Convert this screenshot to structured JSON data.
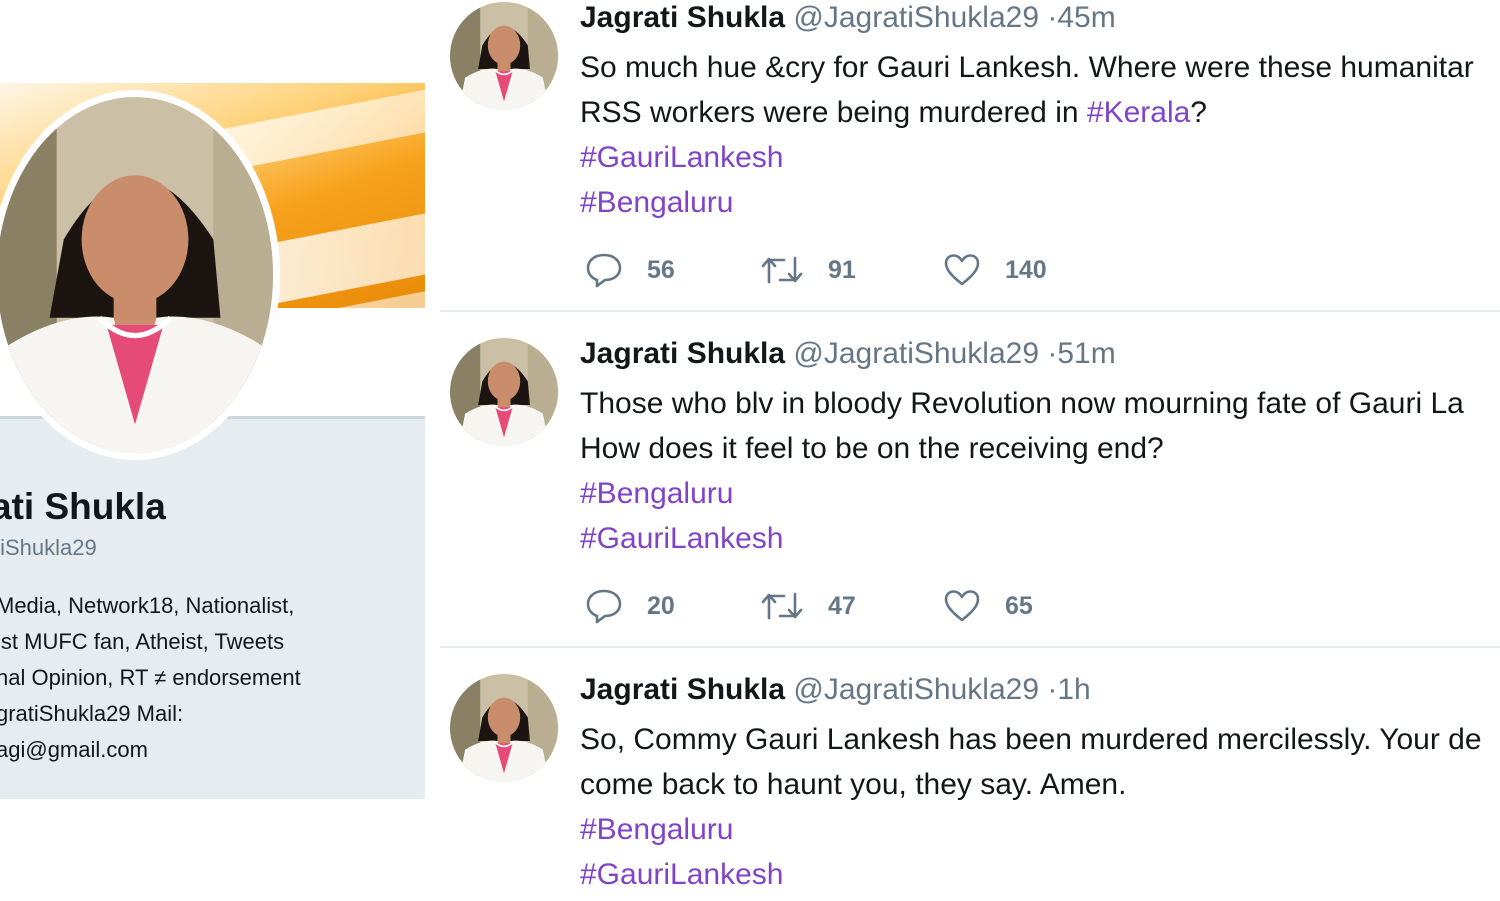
{
  "profile": {
    "name": "ati Shukla",
    "handle": "tiShukla29",
    "bio_lines": [
      "Media, Network18, Nationalist,",
      "ist MUFC fan, Atheist, Tweets",
      "nal Opinion, RT ≠ endorsement",
      "gratiShukla29 Mail:",
      "agi@gmail.com"
    ]
  },
  "tweets": [
    {
      "name": "Jagrati Shukla",
      "handle": "@JagratiShukla29",
      "time": "45m",
      "line1": "So much hue &cry for Gauri Lankesh. Where were these humanitar",
      "line2_text": "RSS workers were being murdered in ",
      "line2_tag": "#Kerala",
      "line2_tail": "?",
      "tag_a": "#GauriLankesh",
      "tag_b": "#Bengaluru",
      "replies": "56",
      "retweets": "91",
      "likes": "140"
    },
    {
      "name": "Jagrati Shukla",
      "handle": "@JagratiShukla29",
      "time": "51m",
      "line1": "Those who blv in bloody Revolution now mourning fate of Gauri La",
      "line2": "How does it feel to be on the receiving end?",
      "tag_a": "#Bengaluru",
      "tag_b": "#GauriLankesh",
      "replies": "20",
      "retweets": "47",
      "likes": "65"
    },
    {
      "name": "Jagrati Shukla",
      "handle": "@JagratiShukla29",
      "time": "1h",
      "line1": "So, Commy Gauri Lankesh has been murdered mercilessly. Your de",
      "line2": "come back to haunt you, they say. Amen.",
      "tag_a": "#Bengaluru",
      "tag_b": "#GauriLankesh"
    }
  ],
  "icons": {
    "reply": "reply-icon",
    "retweet": "retweet-icon",
    "like": "heart-icon"
  },
  "colors": {
    "hashtag": "#8144c9",
    "muted": "#657786",
    "profile_panel": "#e6ecf0"
  }
}
